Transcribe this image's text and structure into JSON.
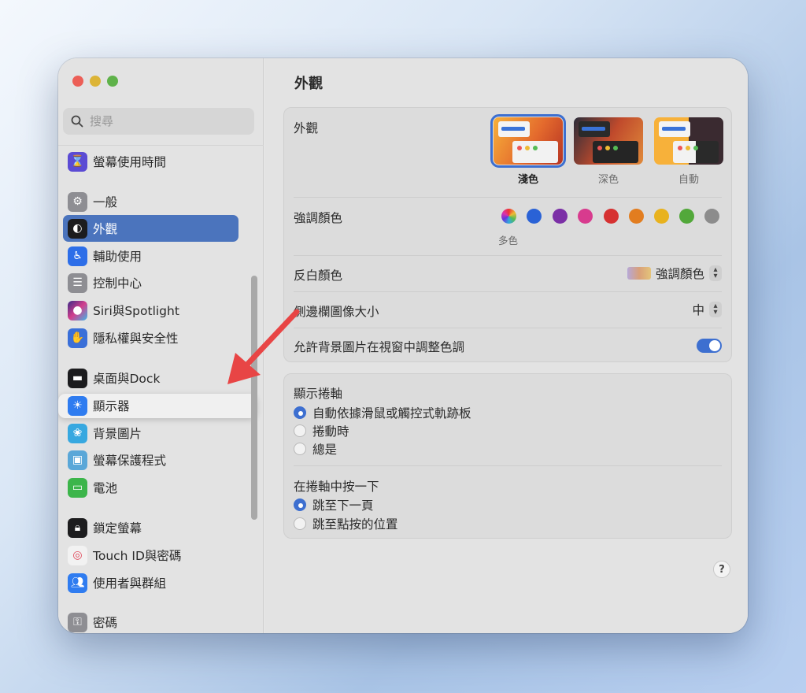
{
  "sidebar": {
    "search_placeholder": "搜尋",
    "items": [
      {
        "label": "螢幕使用時間",
        "icon": "hourglass-icon",
        "color": "#5b4bd4"
      },
      {
        "label": "一般",
        "icon": "gear-icon",
        "color": "#8e8e93"
      },
      {
        "label": "外觀",
        "icon": "appearance-icon",
        "color": "#1c1c1e"
      },
      {
        "label": "輔助使用",
        "icon": "accessibility-icon",
        "color": "#2d6ee8"
      },
      {
        "label": "控制中心",
        "icon": "control-center-icon",
        "color": "#8e8e93"
      },
      {
        "label": "Siri與Spotlight",
        "icon": "siri-icon",
        "color": "#9a4bd8"
      },
      {
        "label": "隱私權與安全性",
        "icon": "hand-icon",
        "color": "#3a6fd8"
      },
      {
        "label": "桌面與Dock",
        "icon": "dock-icon",
        "color": "#1c1c1e"
      },
      {
        "label": "顯示器",
        "icon": "sun-icon",
        "color": "#2f7cf0"
      },
      {
        "label": "背景圖片",
        "icon": "flower-icon",
        "color": "#37a8e0"
      },
      {
        "label": "螢幕保護程式",
        "icon": "screensaver-icon",
        "color": "#5aa7d8"
      },
      {
        "label": "電池",
        "icon": "battery-icon",
        "color": "#3cb54a"
      },
      {
        "label": "鎖定螢幕",
        "icon": "lock-icon",
        "color": "#1c1c1e"
      },
      {
        "label": "Touch ID與密碼",
        "icon": "fingerprint-icon",
        "color": "#f2f2f2"
      },
      {
        "label": "使用者與群組",
        "icon": "users-icon",
        "color": "#2f7cf0"
      },
      {
        "label": "密碼",
        "icon": "key-icon",
        "color": "#8e8e93"
      }
    ]
  },
  "main": {
    "title": "外觀",
    "appearance": {
      "label": "外觀",
      "options": [
        {
          "caption": "淺色",
          "selected": true
        },
        {
          "caption": "深色",
          "selected": false
        },
        {
          "caption": "自動",
          "selected": false
        }
      ]
    },
    "accent": {
      "label": "強調顏色",
      "caption": "多色",
      "colors": [
        "multicolor",
        "#2a62d6",
        "#7b2fa6",
        "#d83b8e",
        "#d63131",
        "#e27d1f",
        "#e8b21e",
        "#52a83a",
        "#8c8c8c"
      ]
    },
    "highlight": {
      "label": "反白顏色",
      "value": "強調顏色"
    },
    "sidebar_icon_size": {
      "label": "側邊欄圖像大小",
      "value": "中"
    },
    "wallpaper_tinting": {
      "label": "允許背景圖片在視窗中調整色調",
      "on": true
    },
    "scrollbars": {
      "title": "顯示捲軸",
      "options": [
        {
          "label": "自動依據滑鼠或觸控式軌跡板",
          "checked": true
        },
        {
          "label": "捲動時",
          "checked": false
        },
        {
          "label": "總是",
          "checked": false
        }
      ]
    },
    "click_scrollbar": {
      "title": "在捲軸中按一下",
      "options": [
        {
          "label": "跳至下一頁",
          "checked": true
        },
        {
          "label": "跳至點按的位置",
          "checked": false
        }
      ]
    },
    "help": "?"
  },
  "colors": {
    "accent": "#3d6fd0",
    "selected_sidebar": "#4b74bd",
    "annotation_arrow": "#e84545"
  }
}
